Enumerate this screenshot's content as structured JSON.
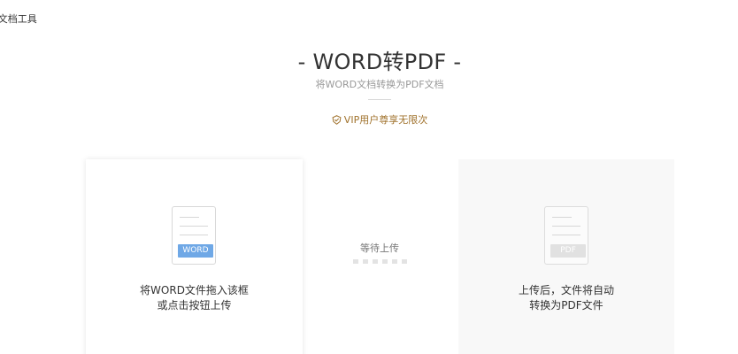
{
  "breadcrumb": "|文档工具",
  "header": {
    "title": "- WORD转PDF -",
    "subtitle": "将WORD文档转换为PDF文档",
    "vip_text": "VIP用户尊享无限次",
    "vip_icon": "vip-shield-icon",
    "accent_color": "#a0722c"
  },
  "upload": {
    "badge": "WORD",
    "badge_color": "#6fa8e6",
    "line1": "将WORD文件拖入该框",
    "line2": "或点击按钮上传"
  },
  "status": {
    "label": "等待上传",
    "dot_count": 6
  },
  "result": {
    "badge": "PDF",
    "badge_color": "#e1e1e1",
    "line1": "上传后，文件将自动",
    "line2": "转换为PDF文件"
  }
}
